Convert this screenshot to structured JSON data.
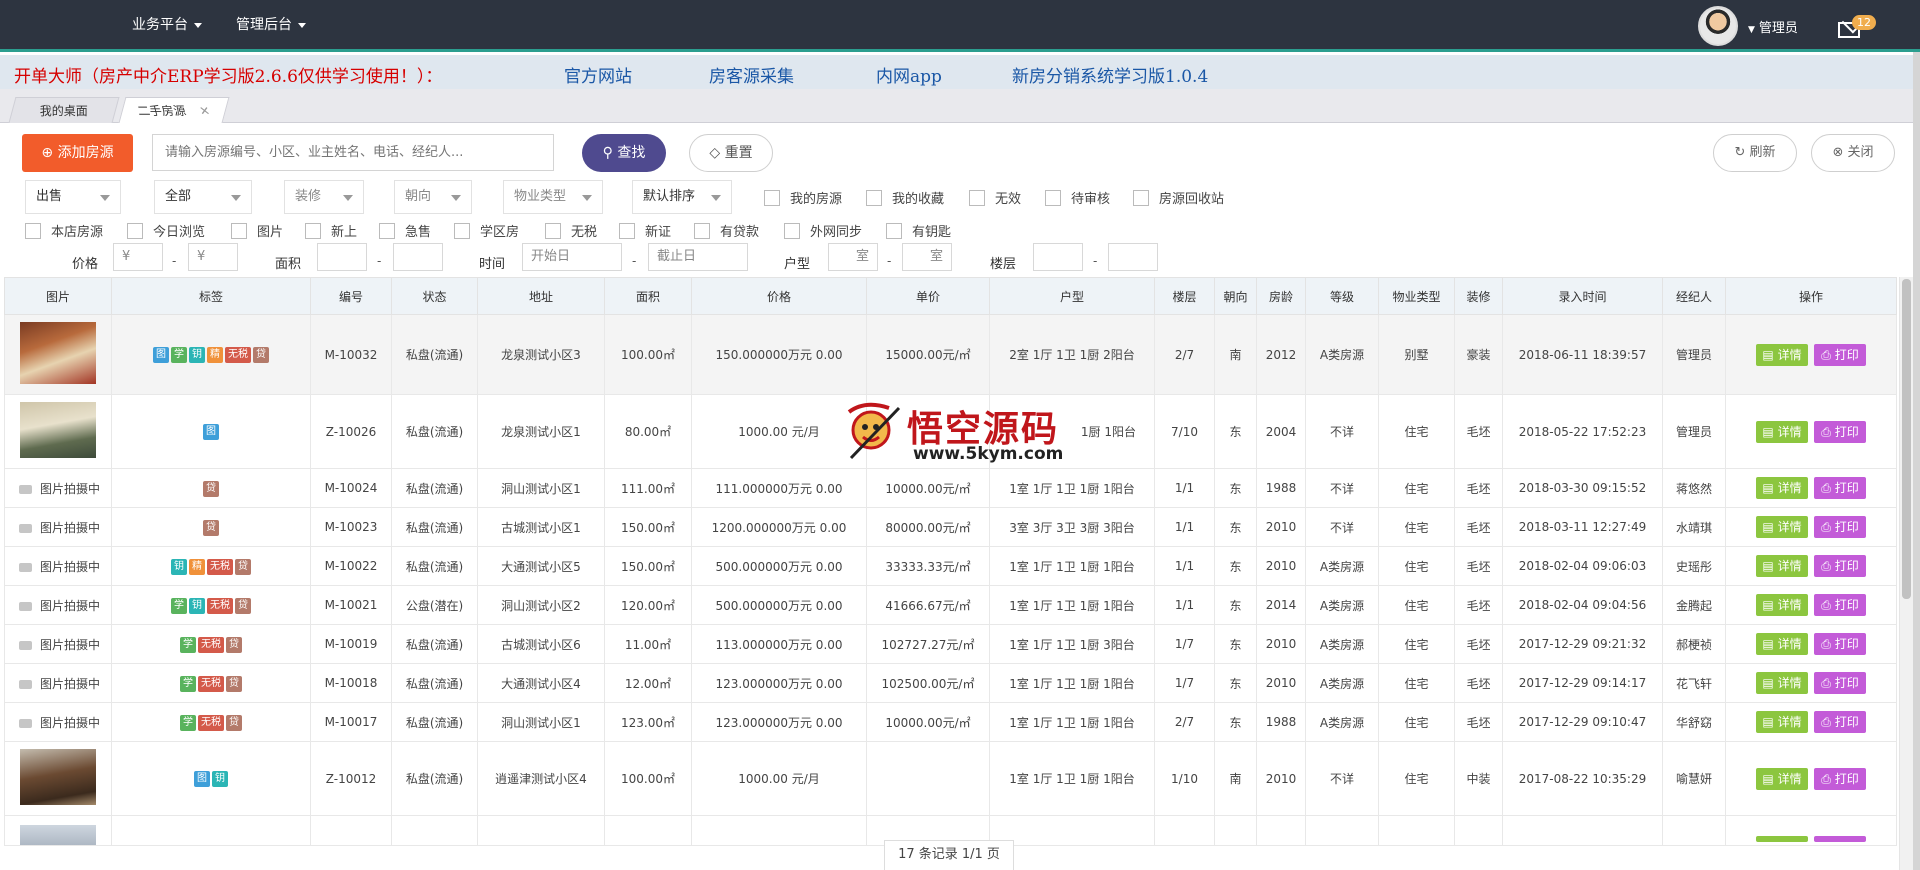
{
  "topbar": {
    "nav": [
      "业务平台",
      "管理后台"
    ],
    "user": "管理员",
    "mail_count": "12"
  },
  "banner": {
    "title": "开单大师（房产中介ERP学习版2.6.6仅供学习使用！）：",
    "links": [
      "官方网站",
      "房客源采集",
      "内网app",
      "新房分销系统学习版1.0.4"
    ]
  },
  "tabs": [
    "我的桌面",
    "二手房源"
  ],
  "toolbar": {
    "add_label": "添加房源",
    "search_placeholder": "请输入房源编号、小区、业主姓名、电话、经纪人...",
    "find_label": "查找",
    "reset_label": "重置",
    "refresh_label": "刷新",
    "close_label": "关闭"
  },
  "filters": {
    "selects": [
      "出售",
      "全部",
      "装修",
      "朝向",
      "物业类型",
      "默认排序"
    ],
    "checks_row1": [
      "我的房源",
      "我的收藏",
      "无效",
      "待审核",
      "房源回收站"
    ],
    "checks_row2": [
      "本店房源",
      "今日浏览",
      "图片",
      "新上",
      "急售",
      "学区房",
      "无税",
      "新证",
      "有贷款",
      "外网同步",
      "有钥匙"
    ],
    "price_label": "价格",
    "currency": "¥",
    "area_label": "面积",
    "time_label": "时间",
    "start_date": "开始日",
    "end_date": "截止日",
    "layout_label": "户型",
    "room": "室",
    "floor_label": "楼层",
    "dash": "-"
  },
  "table": {
    "headers": [
      "图片",
      "标签",
      "编号",
      "状态",
      "地址",
      "面积",
      "价格",
      "单价",
      "户型",
      "楼层",
      "朝向",
      "房龄",
      "等级",
      "物业类型",
      "装修",
      "录入时间",
      "经纪人",
      "操作"
    ],
    "no_photo": "图片拍摄中",
    "detail_label": "详情",
    "print_label": "打印",
    "rows": [
      {
        "code": "M-10032",
        "status": "私盘(流通)",
        "address": "龙泉测试小区3",
        "area": "100.00㎡",
        "price": "150.000000万元 0.00",
        "unit": "15000.00元/㎡",
        "layout": "2室 1厅 1卫 1厨 2阳台",
        "floor": "2/7",
        "dir": "南",
        "year": "2012",
        "grade": "A类房源",
        "ptype": "别墅",
        "deco": "豪装",
        "time": "2018-06-11 18:39:57",
        "agent": "管理员"
      },
      {
        "code": "Z-10026",
        "status": "私盘(流通)",
        "address": "龙泉测试小区1",
        "area": "80.00㎡",
        "price": "1000.00 元/月",
        "unit": "",
        "layout": "1厨 1阳台",
        "floor": "7/10",
        "dir": "东",
        "year": "2004",
        "grade": "不详",
        "ptype": "住宅",
        "deco": "毛坯",
        "time": "2018-05-22 17:52:23",
        "agent": "管理员"
      },
      {
        "code": "M-10024",
        "status": "私盘(流通)",
        "address": "洞山测试小区1",
        "area": "111.00㎡",
        "price": "111.000000万元 0.00",
        "unit": "10000.00元/㎡",
        "layout": "1室 1厅 1卫 1厨 1阳台",
        "floor": "1/1",
        "dir": "东",
        "year": "1988",
        "grade": "不详",
        "ptype": "住宅",
        "deco": "毛坯",
        "time": "2018-03-30 09:15:52",
        "agent": "蒋悠然"
      },
      {
        "code": "M-10023",
        "status": "私盘(流通)",
        "address": "古城测试小区1",
        "area": "150.00㎡",
        "price": "1200.000000万元 0.00",
        "unit": "80000.00元/㎡",
        "layout": "3室 3厅 3卫 3厨 3阳台",
        "floor": "1/1",
        "dir": "东",
        "year": "2010",
        "grade": "不详",
        "ptype": "住宅",
        "deco": "毛坯",
        "time": "2018-03-11 12:27:49",
        "agent": "水靖琪"
      },
      {
        "code": "M-10022",
        "status": "私盘(流通)",
        "address": "大通测试小区5",
        "area": "150.00㎡",
        "price": "500.000000万元 0.00",
        "unit": "33333.33元/㎡",
        "layout": "1室 1厅 1卫 1厨 1阳台",
        "floor": "1/1",
        "dir": "东",
        "year": "2010",
        "grade": "A类房源",
        "ptype": "住宅",
        "deco": "毛坯",
        "time": "2018-02-04 09:06:03",
        "agent": "史瑶彤"
      },
      {
        "code": "M-10021",
        "status": "公盘(潜在)",
        "address": "洞山测试小区2",
        "area": "120.00㎡",
        "price": "500.000000万元 0.00",
        "unit": "41666.67元/㎡",
        "layout": "1室 1厅 1卫 1厨 1阳台",
        "floor": "1/1",
        "dir": "东",
        "year": "2014",
        "grade": "A类房源",
        "ptype": "住宅",
        "deco": "毛坯",
        "time": "2018-02-04 09:04:56",
        "agent": "金腾起"
      },
      {
        "code": "M-10019",
        "status": "私盘(流通)",
        "address": "古城测试小区6",
        "area": "11.00㎡",
        "price": "113.000000万元 0.00",
        "unit": "102727.27元/㎡",
        "layout": "1室 1厅 1卫 1厨 3阳台",
        "floor": "1/7",
        "dir": "东",
        "year": "2010",
        "grade": "A类房源",
        "ptype": "住宅",
        "deco": "毛坯",
        "time": "2017-12-29 09:21:32",
        "agent": "郝梗祯"
      },
      {
        "code": "M-10018",
        "status": "私盘(流通)",
        "address": "大通测试小区4",
        "area": "12.00㎡",
        "price": "123.000000万元 0.00",
        "unit": "102500.00元/㎡",
        "layout": "1室 1厅 1卫 1厨 1阳台",
        "floor": "1/7",
        "dir": "东",
        "year": "2010",
        "grade": "A类房源",
        "ptype": "住宅",
        "deco": "毛坯",
        "time": "2017-12-29 09:14:17",
        "agent": "花飞轩"
      },
      {
        "code": "M-10017",
        "status": "私盘(流通)",
        "address": "洞山测试小区1",
        "area": "123.00㎡",
        "price": "123.000000万元 0.00",
        "unit": "10000.00元/㎡",
        "layout": "1室 1厅 1卫 1厨 1阳台",
        "floor": "2/7",
        "dir": "东",
        "year": "1988",
        "grade": "A类房源",
        "ptype": "住宅",
        "deco": "毛坯",
        "time": "2017-12-29 09:10:47",
        "agent": "华舒窈"
      },
      {
        "code": "Z-10012",
        "status": "私盘(流通)",
        "address": "逍遥津测试小区4",
        "area": "100.00㎡",
        "price": "1000.00 元/月",
        "unit": "",
        "layout": "1室 1厅 1卫 1厨 1阳台",
        "floor": "1/10",
        "dir": "南",
        "year": "2010",
        "grade": "不详",
        "ptype": "住宅",
        "deco": "中装",
        "time": "2017-08-22 10:35:29",
        "agent": "喻慧妍"
      }
    ]
  },
  "tags": {
    "pic": "图",
    "school": "学",
    "key": "钥",
    "fine": "精",
    "notax": "无税",
    "loan": "贷"
  },
  "pager": "17 条记录 1/1 页",
  "watermark": {
    "title": "悟空源码",
    "url": "www.5kym.com"
  },
  "colors": {
    "accent_orange": "#f25c2b",
    "find_purple": "#4f4a8f",
    "code_red": "#d9534f",
    "detail_green": "#8cc63f",
    "print_purple": "#c35bd8"
  }
}
